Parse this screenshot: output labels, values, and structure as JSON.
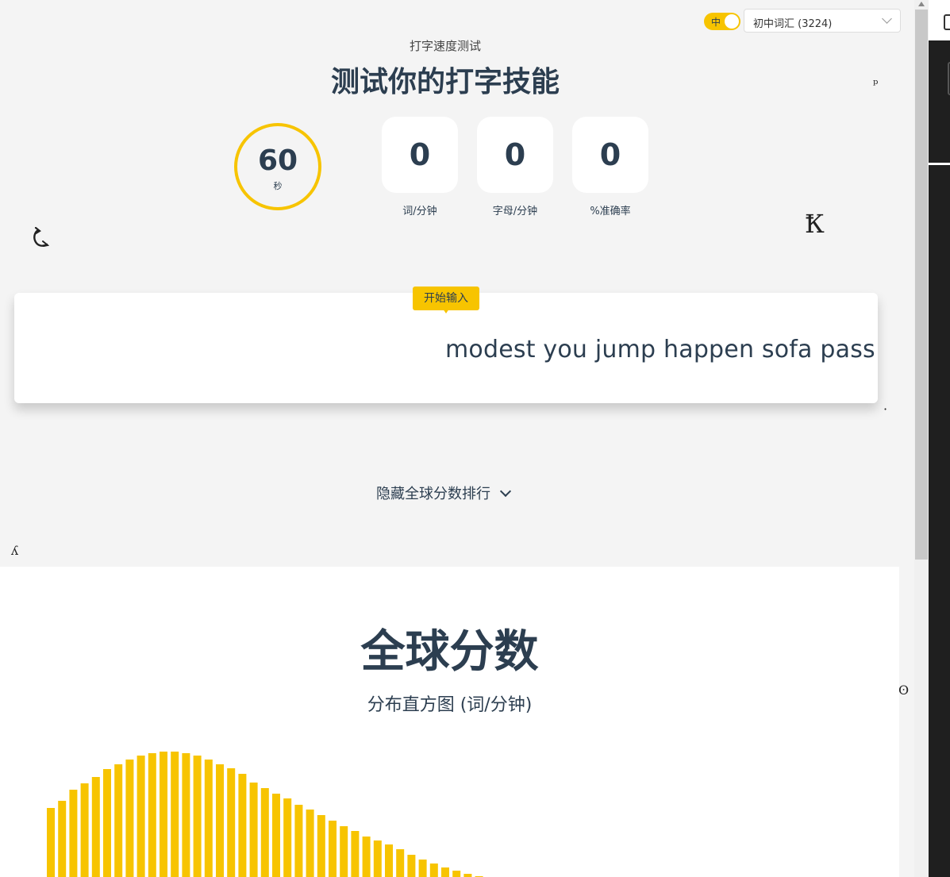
{
  "header": {
    "lang_toggle_label": "中",
    "vocab_select_value": "初中词汇 (3224)",
    "eyebrow": "打字速度测试",
    "title": "测试你的打字技能"
  },
  "timer": {
    "value": "60",
    "unit": "秒"
  },
  "stats": [
    {
      "value": "0",
      "label": "词/分钟"
    },
    {
      "value": "0",
      "label": "字母/分钟"
    },
    {
      "value": "0",
      "label": "%准确率"
    }
  ],
  "typing": {
    "start_hint": "开始输入",
    "words": "modest you jump happen sofa pass pa"
  },
  "leaderboard_toggle": "隐藏全球分数排行",
  "global_scores": {
    "title": "全球分数",
    "subtitle": "分布直方图 (词/分钟)"
  },
  "colors": {
    "accent": "#f7c400",
    "text": "#2c3e50"
  },
  "chart_data": {
    "type": "bar",
    "values": [
      87,
      96,
      110,
      118,
      126,
      136,
      142,
      148,
      153,
      156,
      158,
      158,
      156,
      153,
      148,
      142,
      137,
      130,
      119,
      112,
      105,
      99,
      91,
      85,
      78,
      71,
      64,
      58,
      51,
      46,
      41,
      35,
      28,
      22,
      17,
      12,
      8,
      4,
      1
    ],
    "title": "",
    "xlabel": "",
    "ylabel": ""
  }
}
